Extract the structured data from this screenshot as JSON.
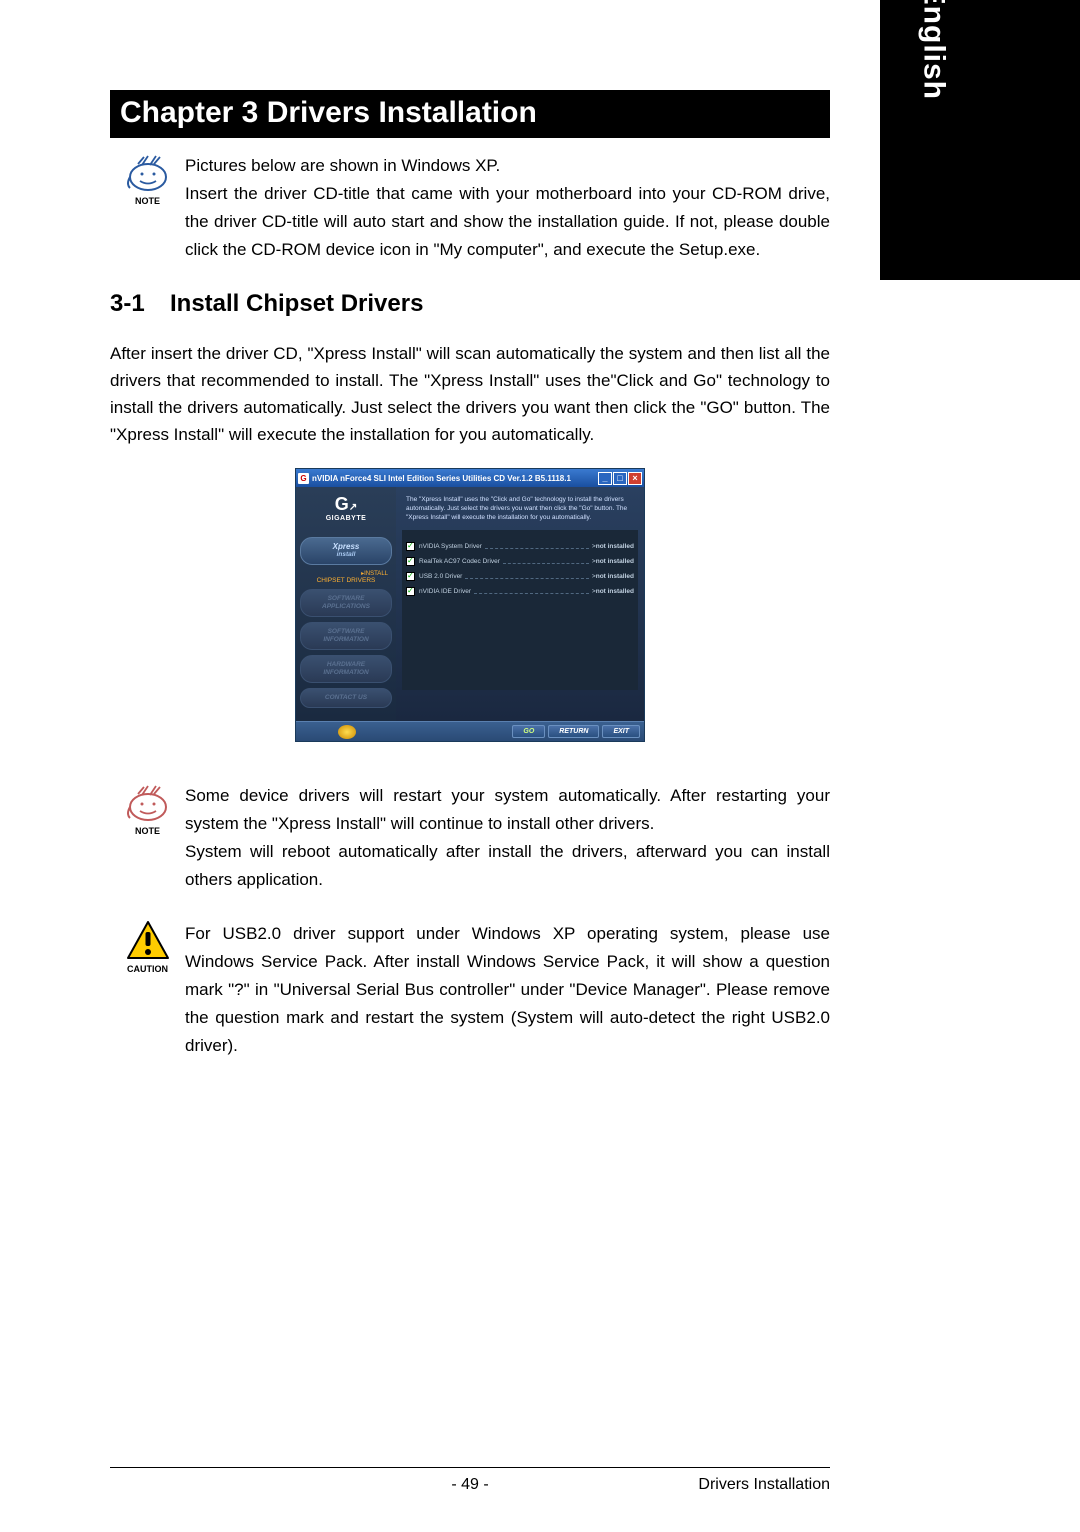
{
  "side_tab": "English",
  "chapter_title": "Chapter 3 Drivers Installation",
  "note1": {
    "label": "NOTE",
    "text": "Pictures below are shown in Windows XP.\nInsert the driver CD-title that came with your motherboard into your CD-ROM drive, the driver CD-title will auto start and show the installation guide. If not, please double click the CD-ROM device icon in \"My computer\", and execute the Setup.exe."
  },
  "section": {
    "number": "3-1",
    "title": "Install Chipset Drivers"
  },
  "intro_para": "After insert the driver CD, \"Xpress Install\" will  scan automatically the system and then list all the drivers that recommended to install. The \"Xpress Install\" uses the\"Click and Go\" technology to install the drivers automatically. Just select the drivers you want then click the \"GO\" button. The \"Xpress Install\" will execute the installation for you automatically.",
  "app": {
    "title": "nVIDIA nForce4 SLI Intel Edition Series Utilities CD Ver.1.2 B5.1118.1",
    "brand": "GIGABYTE",
    "nav": {
      "xpress_line1": "Xpress",
      "xpress_line2": "install",
      "install": "▸INSTALL",
      "chipset": "CHIPSET DRIVERS",
      "soft_apps": "SOFTWARE\nAPPLICATIONS",
      "soft_info": "SOFTWARE\nINFORMATION",
      "hw_info": "HARDWARE\nINFORMATION",
      "contact": "CONTACT US"
    },
    "intro": "The \"Xpress Install\" uses the \"Click and Go\" technology to install the drivers automatically. Just select the drivers you want then click the \"Go\" button. The \"Xpress Install\" will execute the installation for you automatically.",
    "drivers": [
      {
        "name": "nVIDIA System Driver",
        "status": "not installed"
      },
      {
        "name": "RealTek AC97 Codec Driver",
        "status": "not installed"
      },
      {
        "name": "USB 2.0 Driver",
        "status": "not installed"
      },
      {
        "name": "nVIDIA IDE Driver",
        "status": "not installed"
      }
    ],
    "buttons": {
      "go": "GO",
      "return": "RETURN",
      "exit": "EXIT"
    }
  },
  "note2": {
    "label": "NOTE",
    "text": "Some device drivers will restart your system automatically. After restarting your system the \"Xpress Install\" will continue to install other drivers.\nSystem will reboot automatically after install the drivers, afterward you can install others application."
  },
  "caution": {
    "label": "CAUTION",
    "text": "For USB2.0 driver support under Windows XP operating system, please use Windows Service Pack. After install Windows Service Pack, it will show a question mark \"?\" in \"Universal Serial Bus controller\" under \"Device Manager\". Please remove the question mark and restart the system (System will auto-detect the right USB2.0 driver)."
  },
  "footer": {
    "page": "- 49 -",
    "right": "Drivers Installation"
  }
}
